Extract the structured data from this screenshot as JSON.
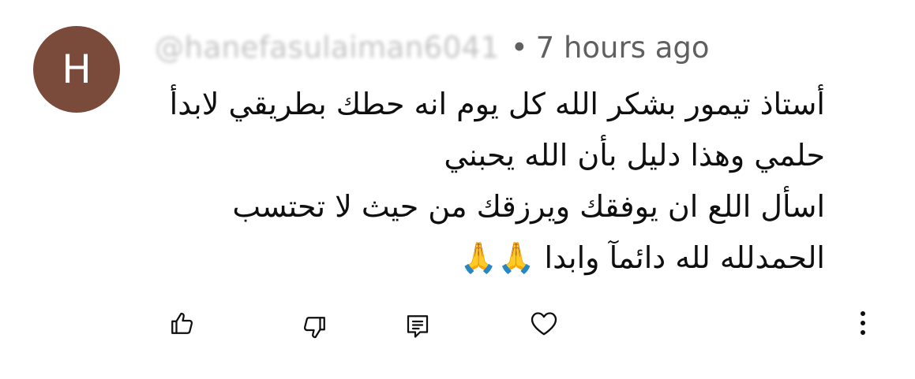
{
  "comment": {
    "avatar_letter": "H",
    "avatar_color": "#7a4b3a",
    "username": "@hanefasulaiman6041",
    "separator": "•",
    "timestamp": "7 hours ago",
    "text_lines": [
      "أستاذ تيمور بشكر الله كل يوم انه حطك بطريقي لابدأ",
      "حلمي وهذا دليل بأن الله يحبني",
      "اسأل اللع ان يوفقك ويرزقك من حيث لا تحتسب",
      "الحمدلله لله دائمآ وابدا 🙏🙏"
    ]
  },
  "actions": {
    "like_icon": "thumbs-up-icon",
    "dislike_icon": "thumbs-down-icon",
    "reply_icon": "reply-icon",
    "heart_icon": "heart-icon",
    "more_icon": "more-vertical-icon"
  },
  "colors": {
    "text_primary": "#0f0f0f",
    "text_secondary": "#606060"
  }
}
